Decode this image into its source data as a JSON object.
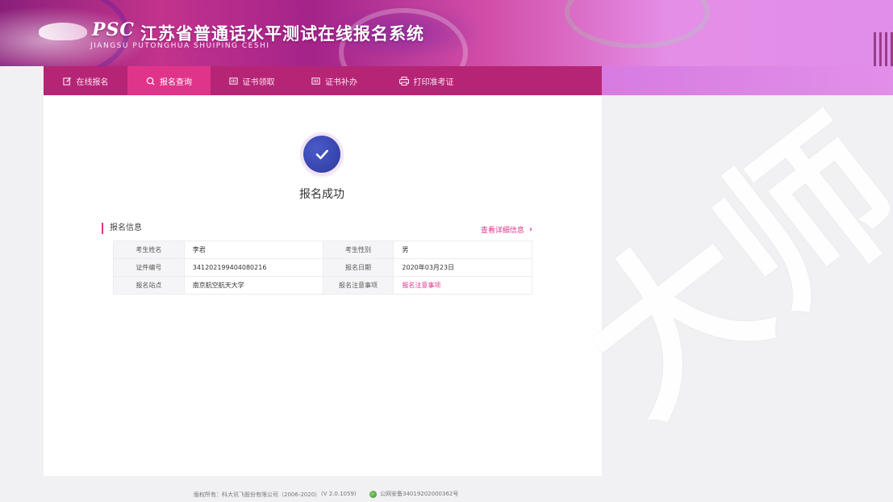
{
  "header": {
    "logo_abbr": "PSC",
    "title": "江苏省普通话水平测试在线报名系统",
    "subtitle": "JIANGSU PUTONGHUA SHUIPING CESHI"
  },
  "nav": {
    "items": [
      {
        "label": "在线报名",
        "icon": "edit-icon"
      },
      {
        "label": "报名查询",
        "icon": "search-icon"
      },
      {
        "label": "证书领取",
        "icon": "certificate-icon"
      },
      {
        "label": "证书补办",
        "icon": "certificate-icon"
      },
      {
        "label": "打印准考证",
        "icon": "printer-icon"
      }
    ],
    "active_index": 1
  },
  "status": {
    "message": "报名成功",
    "icon": "check-icon"
  },
  "info": {
    "section_title": "报名信息",
    "detail_link": "查看详细信息",
    "rows": [
      {
        "label1": "考生姓名",
        "value1": "李君",
        "label2": "考生性别",
        "value2": "男"
      },
      {
        "label1": "证件编号",
        "value1": "341202199404080216",
        "label2": "报名日期",
        "value2": "2020年03月23日"
      },
      {
        "label1": "报名站点",
        "value1": "南京航空航天大学",
        "label2": "报名注意事项",
        "value2": "报名注意事项"
      }
    ]
  },
  "footer": {
    "copyright": "版权所有：科大讯飞股份有限公司（2006-2020）",
    "version": "(V 2.0.1059)",
    "beian": "公网安备34019202000362号"
  },
  "watermark": {
    "text": "大师"
  },
  "colors": {
    "accent": "#e0348a",
    "nav_bg": "#b62575",
    "badge": "#2d3a9e"
  }
}
